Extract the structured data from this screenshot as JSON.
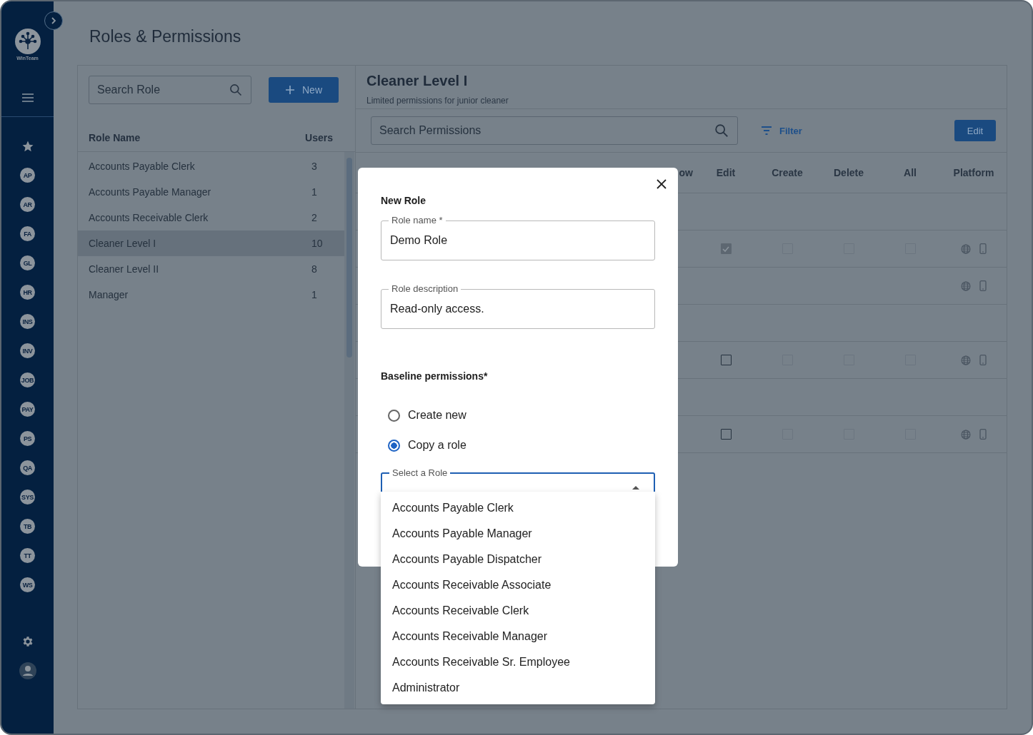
{
  "sidebar": {
    "logo_text": "WinTeam",
    "modules": [
      "AP",
      "AR",
      "FA",
      "GL",
      "HR",
      "INS",
      "INV",
      "JOB",
      "PAY",
      "PS",
      "QA",
      "SYS",
      "TB",
      "TT",
      "WS"
    ]
  },
  "page": {
    "title": "Roles & Permissions"
  },
  "roles_panel": {
    "search": {
      "placeholder": "Search Role"
    },
    "new_button": "New",
    "columns": [
      "Role Name",
      "Users"
    ],
    "rows": [
      {
        "name": "Accounts Payable Clerk",
        "users": "3",
        "selected": false
      },
      {
        "name": "Accounts Payable Manager",
        "users": "1",
        "selected": false
      },
      {
        "name": "Accounts Receivable Clerk",
        "users": "2",
        "selected": false
      },
      {
        "name": "Cleaner Level I",
        "users": "10",
        "selected": true
      },
      {
        "name": "Cleaner Level II",
        "users": "8",
        "selected": false
      },
      {
        "name": "Manager",
        "users": "1",
        "selected": false
      }
    ]
  },
  "role_detail": {
    "title": "Cleaner Level I",
    "description": "Limited permissions for junior cleaner",
    "search": {
      "placeholder": "Search Permissions"
    },
    "filter_button": "Filter",
    "edit_button": "Edit",
    "columns": [
      "ow",
      "Edit",
      "Create",
      "Delete",
      "All",
      "Platform"
    ],
    "rows": [
      {
        "kind": "blank"
      },
      {
        "kind": "permission",
        "edit": {
          "checked": true,
          "disabled": true
        },
        "create": {
          "checked": false,
          "disabled": true
        },
        "delete": {
          "checked": false,
          "disabled": true
        },
        "all": {
          "checked": false,
          "disabled": true
        }
      },
      {
        "kind": "platform"
      },
      {
        "kind": "blank"
      },
      {
        "kind": "permission",
        "edit": {
          "checked": false,
          "disabled": false
        },
        "create": {
          "checked": false,
          "disabled": true
        },
        "delete": {
          "checked": false,
          "disabled": true
        },
        "all": {
          "checked": false,
          "disabled": true
        }
      },
      {
        "kind": "blank"
      },
      {
        "kind": "permission",
        "edit": {
          "checked": false,
          "disabled": false
        },
        "create": {
          "checked": false,
          "disabled": true
        },
        "delete": {
          "checked": false,
          "disabled": true
        },
        "all": {
          "checked": false,
          "disabled": true
        }
      }
    ]
  },
  "modal": {
    "title": "New Role",
    "role_name": {
      "label": "Role name *",
      "value": "Demo Role"
    },
    "role_description": {
      "label": "Role description",
      "value": "Read-only access."
    },
    "baseline": {
      "label": "Baseline permissions*",
      "options": [
        {
          "label": "Create new",
          "selected": false
        },
        {
          "label": "Copy a role",
          "selected": true
        }
      ]
    },
    "select_role": {
      "label": "Select a Role",
      "expanded": true,
      "options": [
        "Accounts Payable Clerk",
        "Accounts Payable Manager",
        "Accounts Payable Dispatcher",
        "Accounts Receivable Associate",
        "Accounts Receivable Clerk",
        "Accounts Receivable Manager",
        "Accounts Receivable Sr. Employee",
        "Administrator"
      ]
    }
  }
}
